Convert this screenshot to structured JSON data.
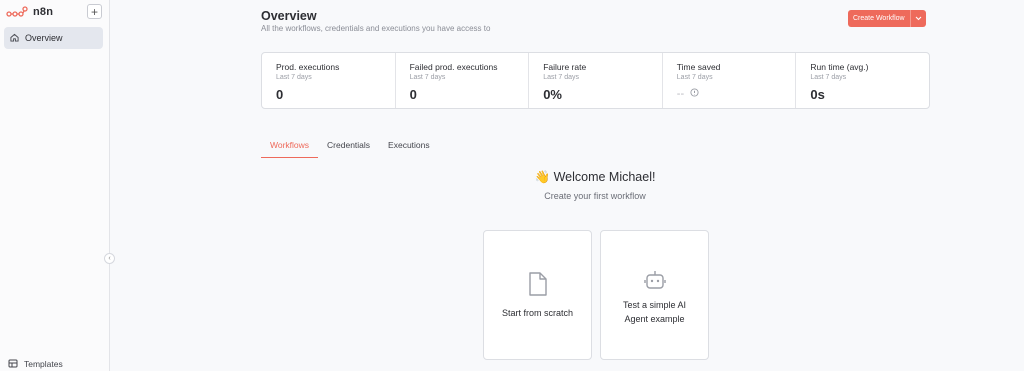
{
  "sidebar": {
    "brand": "n8n",
    "add_label": "+",
    "nav_overview": "Overview",
    "templates": "Templates",
    "collapse_glyph": "‹"
  },
  "header": {
    "title": "Overview",
    "subtitle": "All the workflows, credentials and executions you have access to",
    "create_button": "Create Workflow"
  },
  "stats": [
    {
      "label": "Prod. executions",
      "period": "Last 7 days",
      "value": "0"
    },
    {
      "label": "Failed prod. executions",
      "period": "Last 7 days",
      "value": "0"
    },
    {
      "label": "Failure rate",
      "period": "Last 7 days",
      "value": "0%"
    },
    {
      "label": "Time saved",
      "period": "Last 7 days",
      "value": "--"
    },
    {
      "label": "Run time (avg.)",
      "period": "Last 7 days",
      "value": "0s"
    }
  ],
  "tabs": [
    "Workflows",
    "Credentials",
    "Executions"
  ],
  "welcome": {
    "emoji": "👋",
    "title": "Welcome Michael!",
    "subtitle": "Create your first workflow"
  },
  "cards": [
    {
      "label": "Start from scratch",
      "icon": "file-icon"
    },
    {
      "label_line1": "Test a simple AI",
      "label_line2": "Agent example",
      "icon": "robot-icon"
    }
  ],
  "colors": {
    "accent": "#ee6a5b",
    "sidebar_active": "#e4e7ee"
  }
}
